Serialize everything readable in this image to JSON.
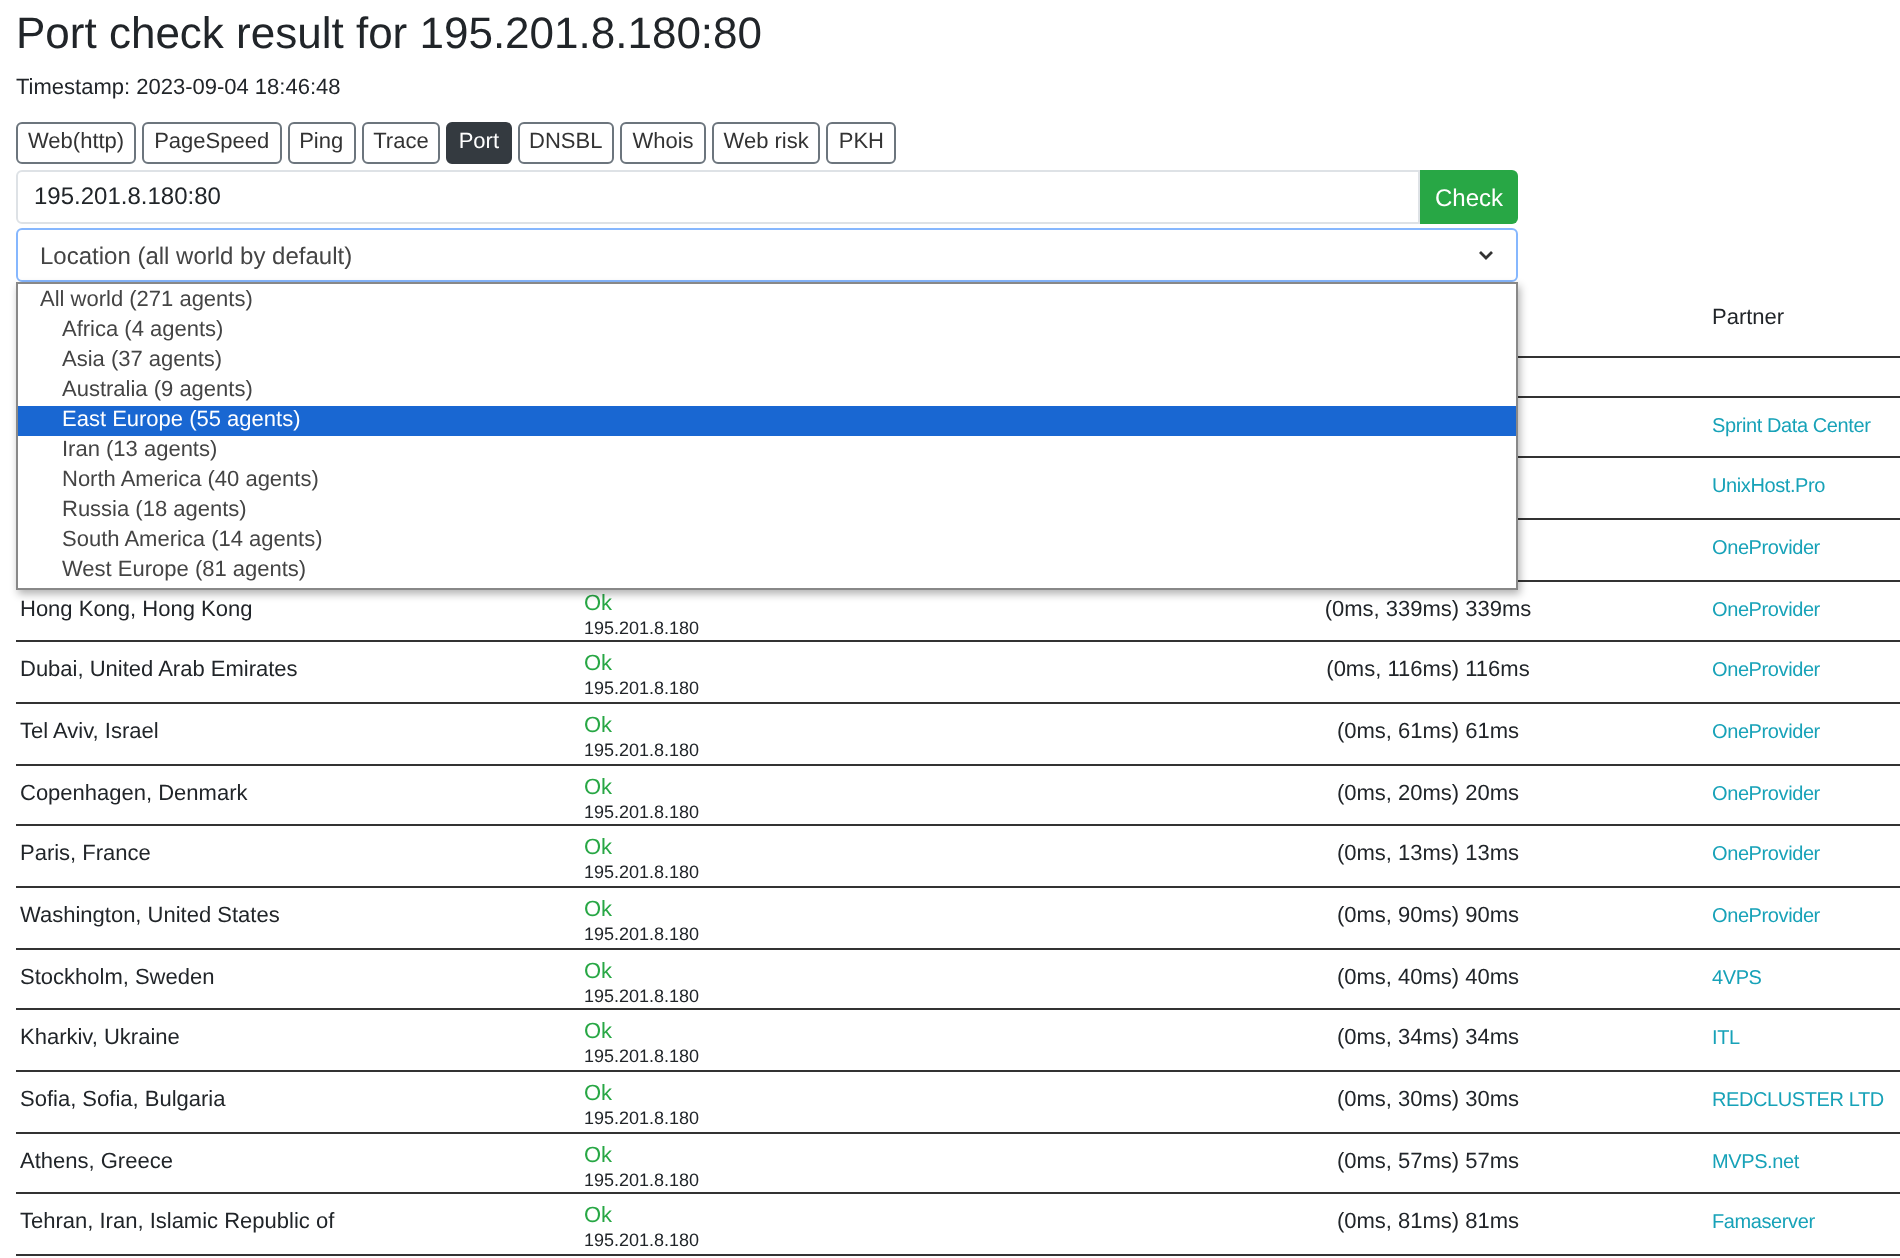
{
  "title": "Port check result for 195.201.8.180:80",
  "timestamp": "Timestamp: 2023-09-04 18:46:48",
  "tabs": [
    {
      "label": "Web(http)",
      "selected": false
    },
    {
      "label": "PageSpeed",
      "selected": false
    },
    {
      "label": "Ping",
      "selected": false
    },
    {
      "label": "Trace",
      "selected": false
    },
    {
      "label": "Port",
      "selected": true
    },
    {
      "label": "DNSBL",
      "selected": false
    },
    {
      "label": "Whois",
      "selected": false
    },
    {
      "label": "Web risk",
      "selected": false
    },
    {
      "label": "PKH",
      "selected": false
    }
  ],
  "host_field": {
    "value": "195.201.8.180:80"
  },
  "check_button": "Check",
  "location_select": {
    "value": "Location (all world by default)",
    "expanded": true,
    "options": [
      {
        "label": "All world (271 agents)",
        "selected": false,
        "children": [
          {
            "label": "Africa (4 agents)",
            "selected": false
          },
          {
            "label": "Asia (37 agents)",
            "selected": false
          },
          {
            "label": "Australia (9 agents)",
            "selected": false
          },
          {
            "label": "East Europe (55 agents)",
            "selected": true
          },
          {
            "label": "Iran (13 agents)",
            "selected": false
          },
          {
            "label": "North America (40 agents)",
            "selected": false
          },
          {
            "label": "Russia (18 agents)",
            "selected": false
          },
          {
            "label": "South America (14 agents)",
            "selected": false
          },
          {
            "label": "West Europe (81 agents)",
            "selected": false
          }
        ]
      }
    ]
  },
  "table": {
    "columns": [
      {
        "label": "Partner"
      }
    ],
    "rows": [
      {},
      {
        "partner": "Sprint Data Center"
      },
      {
        "partner": "UnixHost.Pro"
      },
      {
        "partner": "OneProvider"
      },
      {
        "location": "Hong Kong, Hong Kong",
        "result": "Ok",
        "ip": "195.201.8.180",
        "time": "(0ms, 339ms) 339ms",
        "partner": "OneProvider"
      },
      {
        "location": "Dubai, United Arab Emirates",
        "result": "Ok",
        "ip": "195.201.8.180",
        "time": "(0ms, 116ms) 116ms",
        "partner": "OneProvider"
      },
      {
        "location": "Tel Aviv, Israel",
        "result": "Ok",
        "ip": "195.201.8.180",
        "time": "(0ms, 61ms) 61ms",
        "partner": "OneProvider"
      },
      {
        "location": "Copenhagen, Denmark",
        "result": "Ok",
        "ip": "195.201.8.180",
        "time": "(0ms, 20ms) 20ms",
        "partner": "OneProvider"
      },
      {
        "location": "Paris, France",
        "result": "Ok",
        "ip": "195.201.8.180",
        "time": "(0ms, 13ms) 13ms",
        "partner": "OneProvider"
      },
      {
        "location": "Washington, United States",
        "result": "Ok",
        "ip": "195.201.8.180",
        "time": "(0ms, 90ms) 90ms",
        "partner": "OneProvider"
      },
      {
        "location": "Stockholm, Sweden",
        "result": "Ok",
        "ip": "195.201.8.180",
        "time": "(0ms, 40ms) 40ms",
        "partner": "4VPS"
      },
      {
        "location": "Kharkiv, Ukraine",
        "result": "Ok",
        "ip": "195.201.8.180",
        "time": "(0ms, 34ms) 34ms",
        "partner": "ITL"
      },
      {
        "location": "Sofia, Sofia, Bulgaria",
        "result": "Ok",
        "ip": "195.201.8.180",
        "time": "(0ms, 30ms) 30ms",
        "partner": "REDCLUSTER LTD"
      },
      {
        "location": "Athens, Greece",
        "result": "Ok",
        "ip": "195.201.8.180",
        "time": "(0ms, 57ms) 57ms",
        "partner": "MVPS.net"
      },
      {
        "location": "Tehran, Iran, Islamic Republic of",
        "result": "Ok",
        "ip": "195.201.8.180",
        "time": "(0ms, 81ms) 81ms",
        "partner": "Famaserver"
      }
    ]
  }
}
